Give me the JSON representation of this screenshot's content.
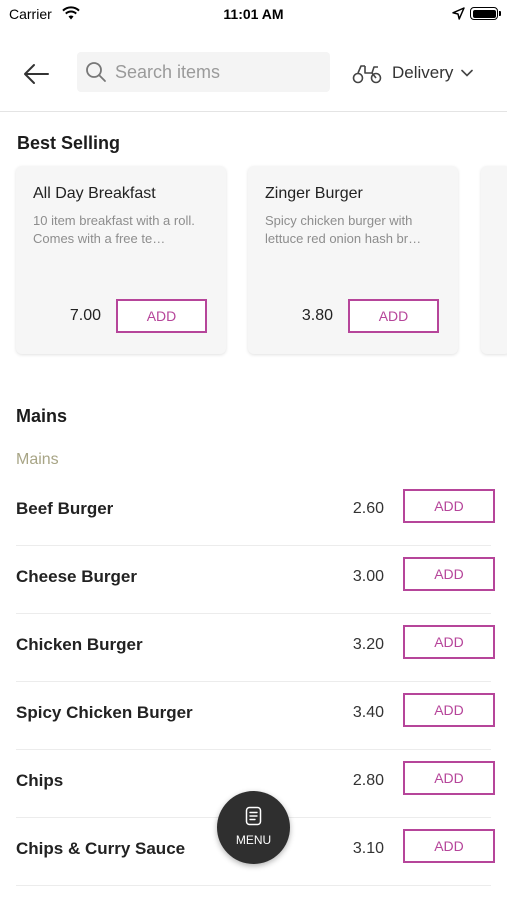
{
  "status_bar": {
    "carrier": "Carrier",
    "time": "11:01 AM"
  },
  "header": {
    "search_placeholder": "Search items",
    "search_value": "",
    "delivery_label": "Delivery"
  },
  "best_selling": {
    "title": "Best Selling",
    "items": [
      {
        "name": "All Day Breakfast",
        "description": "10 item breakfast with a roll. Comes with a free te…",
        "price": "7.00",
        "add_label": "ADD"
      },
      {
        "name": "Zinger Burger",
        "description": "Spicy chicken burger with lettuce red onion hash br…",
        "price": "3.80",
        "add_label": "ADD"
      }
    ]
  },
  "mains": {
    "title": "Mains",
    "subtitle": "Mains",
    "items": [
      {
        "name": "Beef Burger",
        "price": "2.60",
        "add_label": "ADD"
      },
      {
        "name": "Cheese Burger",
        "price": "3.00",
        "add_label": "ADD"
      },
      {
        "name": "Chicken Burger",
        "price": "3.20",
        "add_label": "ADD"
      },
      {
        "name": "Spicy Chicken Burger",
        "price": "3.40",
        "add_label": "ADD"
      },
      {
        "name": "Chips",
        "price": "2.80",
        "add_label": "ADD"
      },
      {
        "name": "Chips & Curry Sauce",
        "price": "3.10",
        "add_label": "ADD"
      }
    ]
  },
  "menu_button": {
    "label": "MENU"
  },
  "colors": {
    "accent": "#b6459a",
    "subtitle": "#a8a586",
    "fab": "#2f2f2f"
  }
}
